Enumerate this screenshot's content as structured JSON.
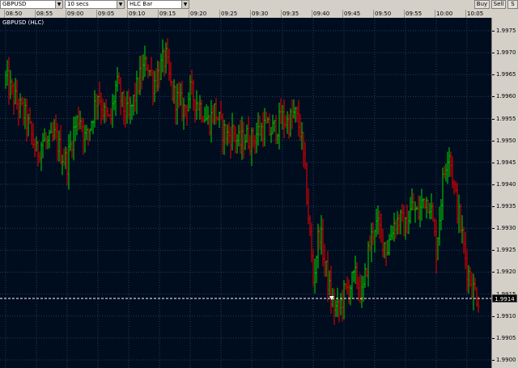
{
  "toolbar": {
    "symbol": "GBPUSD",
    "interval": "10 secs",
    "chart_type": "HLC Bar",
    "buy_label": "Buy",
    "sell_label": "Sell",
    "extra_label": "S"
  },
  "time_labels": [
    "08:50",
    "08:55",
    "09:00",
    "09:05",
    "09:10",
    "09:15",
    "09:20",
    "09:25",
    "09:30",
    "09:35",
    "09:40",
    "09:45",
    "09:50",
    "09:55",
    "10:00",
    "10:05"
  ],
  "chart": {
    "title": "GBPUSD (HLC)",
    "last_price": "1.9914"
  },
  "chart_data": {
    "type": "bar",
    "instrument": "GBPUSD",
    "style": "HLC",
    "up_color": "#00c400",
    "down_color": "#e00000",
    "y_ticks": [
      "1.9975",
      "1.9970",
      "1.9965",
      "1.9960",
      "1.9955",
      "1.9950",
      "1.9945",
      "1.9940",
      "1.9935",
      "1.9930",
      "1.9925",
      "1.9920",
      "1.9915",
      "1.9910",
      "1.9905",
      "1.9900"
    ],
    "ylim": [
      1.99,
      1.9975
    ],
    "x_range": [
      "08:50",
      "10:07"
    ],
    "grid": true,
    "last_price_line": 1.9914,
    "price_path": [
      [
        "08:50",
        1.9964
      ],
      [
        "08:52",
        1.9958
      ],
      [
        "08:53",
        1.9956
      ],
      [
        "08:54",
        1.9952
      ],
      [
        "08:55",
        1.9947
      ],
      [
        "08:56",
        1.995
      ],
      [
        "08:57",
        1.9949
      ],
      [
        "08:58",
        1.9951
      ],
      [
        "08:59",
        1.9947
      ],
      [
        "09:00",
        1.9945
      ],
      [
        "09:01",
        1.9952
      ],
      [
        "09:02",
        1.9956
      ],
      [
        "09:03",
        1.995
      ],
      [
        "09:04",
        1.9955
      ],
      [
        "09:05",
        1.9961
      ],
      [
        "09:06",
        1.9956
      ],
      [
        "09:07",
        1.9954
      ],
      [
        "09:08",
        1.9963
      ],
      [
        "09:09",
        1.9958
      ],
      [
        "09:10",
        1.9955
      ],
      [
        "09:11",
        1.996
      ],
      [
        "09:12",
        1.9965
      ],
      [
        "09:13",
        1.9968
      ],
      [
        "09:14",
        1.9963
      ],
      [
        "09:15",
        1.9966
      ],
      [
        "09:16",
        1.9969
      ],
      [
        "09:17",
        1.9961
      ],
      [
        "09:18",
        1.9959
      ],
      [
        "09:19",
        1.9957
      ],
      [
        "09:20",
        1.9961
      ],
      [
        "09:21",
        1.9959
      ],
      [
        "09:22",
        1.9957
      ],
      [
        "09:23",
        1.9954
      ],
      [
        "09:24",
        1.9957
      ],
      [
        "09:25",
        1.9953
      ],
      [
        "09:26",
        1.9951
      ],
      [
        "09:27",
        1.9952
      ],
      [
        "09:28",
        1.9949
      ],
      [
        "09:29",
        1.9951
      ],
      [
        "09:30",
        1.995
      ],
      [
        "09:31",
        1.9952
      ],
      [
        "09:32",
        1.9953
      ],
      [
        "09:33",
        1.9952
      ],
      [
        "09:34",
        1.9953
      ],
      [
        "09:35",
        1.9955
      ],
      [
        "09:36",
        1.9954
      ],
      [
        "09:37",
        1.9956
      ],
      [
        "09:38",
        1.9952
      ],
      [
        "09:39",
        1.9937
      ],
      [
        "09:40",
        1.9918
      ],
      [
        "09:41",
        1.993
      ],
      [
        "09:42",
        1.9921
      ],
      [
        "09:43",
        1.9913
      ],
      [
        "09:44",
        1.9911
      ],
      [
        "09:45",
        1.9915
      ],
      [
        "09:46",
        1.9917
      ],
      [
        "09:47",
        1.9919
      ],
      [
        "09:48",
        1.9914
      ],
      [
        "09:49",
        1.9925
      ],
      [
        "09:50",
        1.9931
      ],
      [
        "09:51",
        1.9929
      ],
      [
        "09:52",
        1.9925
      ],
      [
        "09:53",
        1.9931
      ],
      [
        "09:54",
        1.9932
      ],
      [
        "09:55",
        1.993
      ],
      [
        "09:56",
        1.9935
      ],
      [
        "09:57",
        1.9933
      ],
      [
        "09:58",
        1.9937
      ],
      [
        "09:59",
        1.9936
      ],
      [
        "10:00",
        1.9925
      ],
      [
        "10:01",
        1.994
      ],
      [
        "10:02",
        1.9949
      ],
      [
        "10:03",
        1.9938
      ],
      [
        "10:04",
        1.993
      ],
      [
        "10:05",
        1.9921
      ],
      [
        "10:06",
        1.9916
      ],
      [
        "10:07",
        1.9914
      ]
    ]
  }
}
